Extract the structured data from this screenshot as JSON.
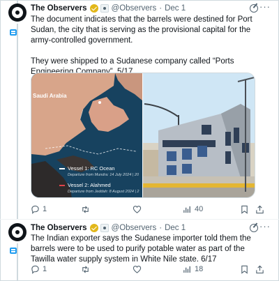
{
  "tweets": [
    {
      "author": "The Observers",
      "handle": "@Observers",
      "separator": "·",
      "date": "Dec 1",
      "paragraphs": [
        "The document indicates that the barrels were destined for Port Sudan, the city that is serving as the provisional capital for the army-controlled government.",
        "They were shipped to a Sudanese company called “Ports Engineering Company”. 5/17"
      ],
      "media": {
        "map": {
          "country_label": "Saudi Arabia",
          "vessel1": "Vessel 1: RC Ocean",
          "vessel1_sub": "Departure from Mundra: 14 July 2024 | 20",
          "vessel2": "Vessel 2: Alahmed",
          "vessel2_sub": "Departure from Jeddah: 8 August 2024 | 2"
        }
      },
      "metrics": {
        "replies": "1",
        "reposts": "",
        "likes": "",
        "views": "40"
      }
    },
    {
      "author": "The Observers",
      "handle": "@Observers",
      "separator": "·",
      "date": "Dec 1",
      "paragraphs": [
        "The Indian exporter says the Sudanese importer told them the barrels were to be used to purify potable water as part of the Tawilla water supply system in White Nile state. 6/17"
      ],
      "metrics": {
        "replies": "1",
        "reposts": "",
        "likes": "",
        "views": "18"
      }
    }
  ],
  "icons": [
    "grok-icon",
    "more-icon",
    "reply-icon",
    "repost-icon",
    "like-icon",
    "views-icon",
    "bookmark-icon",
    "share-icon",
    "verified-badge-icon",
    "affiliate-badge-icon"
  ],
  "colors": {
    "text": "#0f1419",
    "muted": "#536471",
    "border": "#cfd9de",
    "accent": "#1d9bf0",
    "verified": "#e2b719"
  }
}
